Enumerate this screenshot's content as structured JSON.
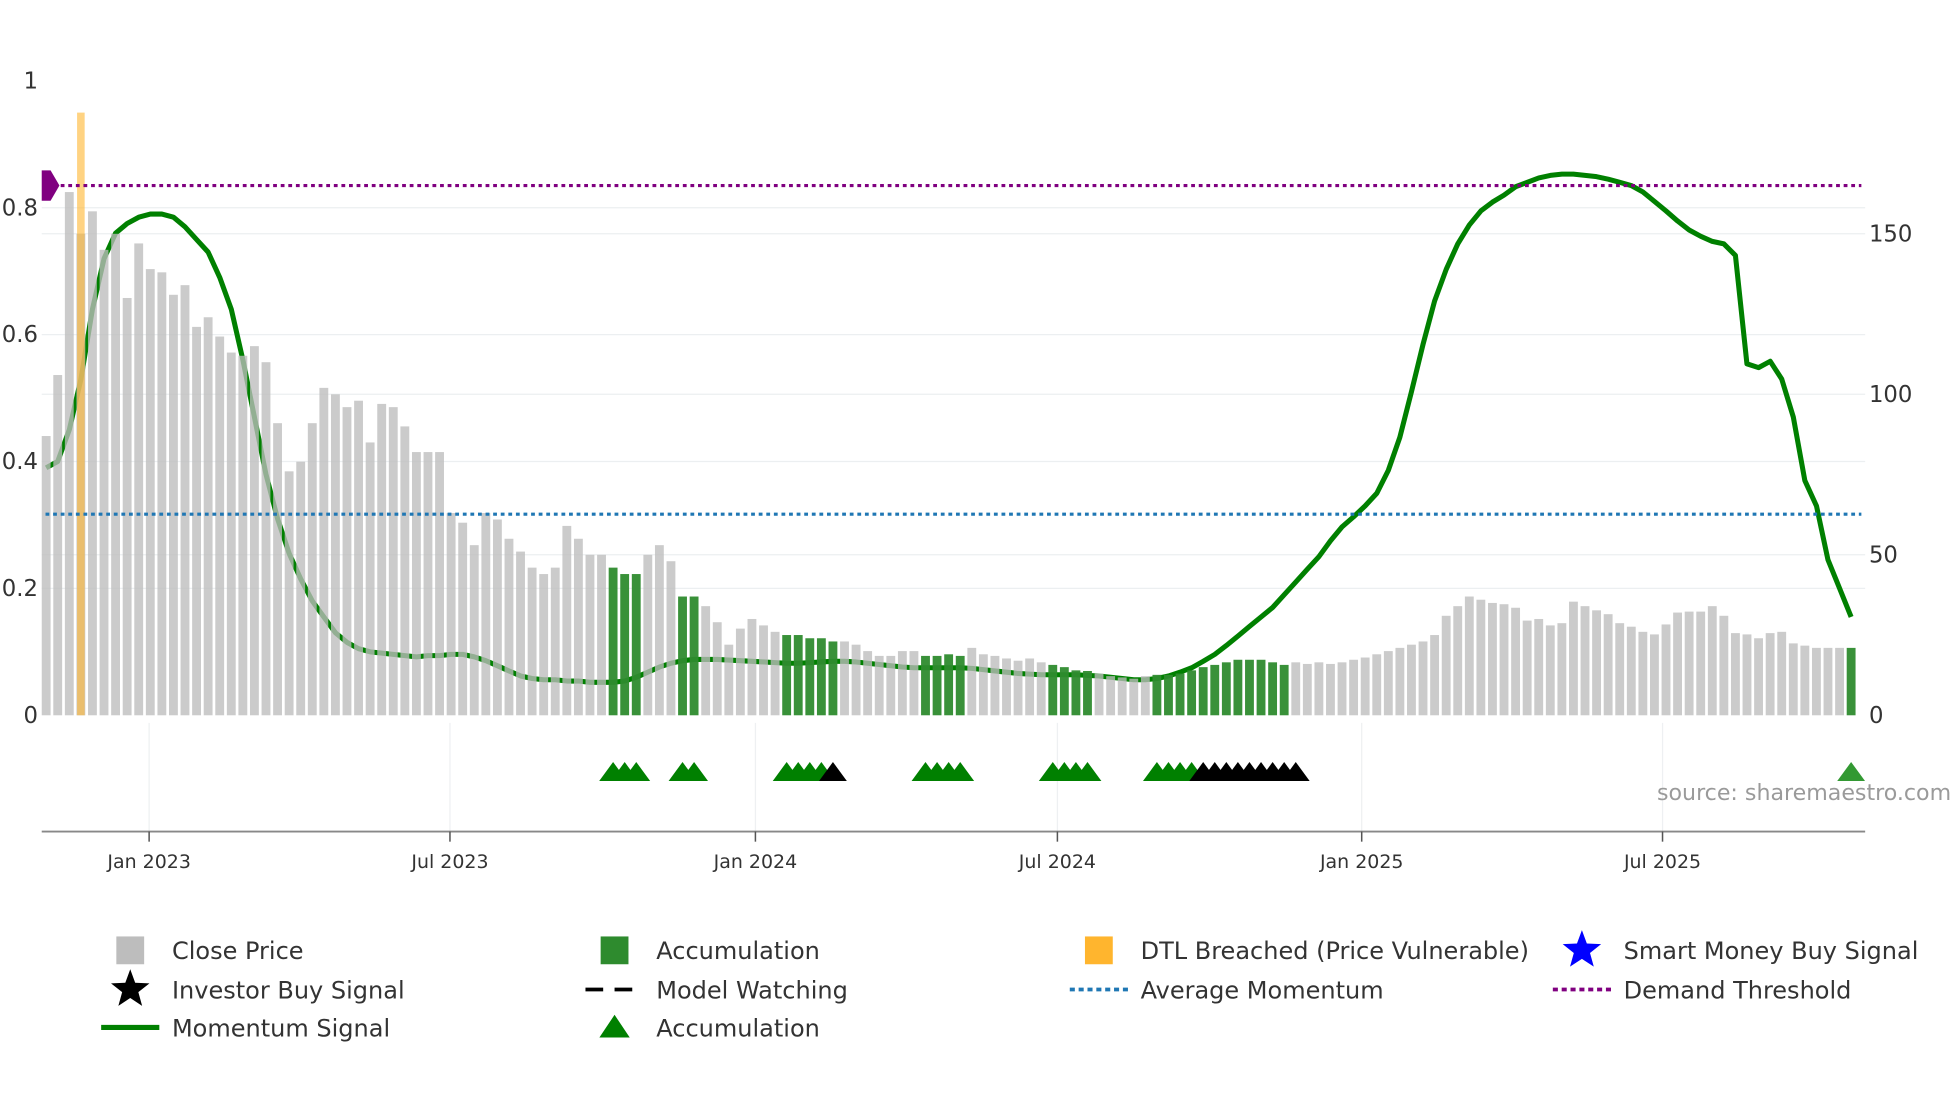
{
  "chart_data": {
    "type": "bar",
    "x_unit": "week index (weekly bars, Nov 2022 - Oct 2025)",
    "colors": {
      "close_price": "#bdbdbd",
      "accumulation_bar": "#2e8b2e",
      "dtl_breached": "#ffb52e",
      "momentum": "#008000",
      "average_momentum": "#1f77b4",
      "demand_threshold": "#800080",
      "investor_signal": "#000000",
      "smart_money": "#0000ff",
      "accumulation_marker": "#008000"
    },
    "left_axis": {
      "ylim": [
        0,
        1
      ],
      "ticks": [
        "0",
        "0.2",
        "0.4",
        "0.6",
        "0.8",
        "1"
      ],
      "tick_values": [
        0,
        0.2,
        0.4,
        0.6,
        0.8,
        1
      ]
    },
    "right_axis": {
      "ylim": [
        0,
        175
      ],
      "ticks": [
        "0",
        "50",
        "100",
        "150"
      ],
      "tick_values": [
        0,
        50,
        100,
        150
      ]
    },
    "x_ticks": [
      {
        "label": "Jan 2023",
        "week": 8.9
      },
      {
        "label": "Jul 2023",
        "week": 34.9
      },
      {
        "label": "Jan 2024",
        "week": 61.3
      },
      {
        "label": "Jul 2024",
        "week": 87.4
      },
      {
        "label": "Jan 2025",
        "week": 113.7
      },
      {
        "label": "Jul 2025",
        "week": 139.7
      }
    ],
    "close_price": [
      87,
      106,
      163,
      150,
      157,
      145,
      150,
      130,
      147,
      139,
      138,
      131,
      134,
      121,
      124,
      118,
      113,
      112,
      115,
      110,
      91,
      76,
      79,
      91,
      102,
      100,
      96,
      98,
      85,
      97,
      96,
      90,
      82,
      82,
      82,
      63,
      60,
      53,
      63,
      61,
      55,
      51,
      46,
      44,
      46,
      59,
      55,
      50,
      50,
      46,
      44,
      44,
      50,
      53,
      48,
      37,
      37,
      34,
      29,
      22,
      27,
      30,
      28,
      26,
      25,
      25,
      24,
      24,
      23,
      23,
      22,
      20,
      18.5,
      18.5,
      20,
      20,
      18.5,
      18.5,
      19,
      18.5,
      21,
      19,
      18.5,
      17.7,
      17,
      17.7,
      16.5,
      15.7,
      15,
      14,
      13.8,
      13,
      12.2,
      11.8,
      11.4,
      12.2,
      12.6,
      12.6,
      13,
      14,
      15,
      15.7,
      16.5,
      17.3,
      17.3,
      17.3,
      16.5,
      15.7,
      16.5,
      16,
      16.5,
      16,
      16.5,
      17.3,
      18,
      19,
      20,
      21,
      22,
      23,
      25,
      31,
      34,
      37,
      36,
      35,
      34.6,
      33.5,
      29.5,
      30,
      28,
      28.7,
      35.4,
      34,
      32.7,
      31.5,
      28.7,
      27.6,
      26,
      25.2,
      28.3,
      32,
      32.3,
      32.3,
      34,
      31,
      25.6,
      25.2,
      24,
      25.6,
      26,
      22.4,
      21.7,
      21,
      21,
      21,
      21
    ],
    "accumulation_weeks": [
      49,
      50,
      51,
      55,
      56,
      64,
      65,
      66,
      67,
      68,
      76,
      77,
      78,
      79,
      87,
      88,
      89,
      90,
      96,
      97,
      98,
      99,
      100,
      101,
      102,
      103,
      104,
      105,
      106,
      107,
      156
    ],
    "dtl_breached": [
      {
        "week": 3,
        "value": 0.95
      }
    ],
    "momentum": [
      0.39,
      0.4,
      0.45,
      0.53,
      0.64,
      0.72,
      0.76,
      0.775,
      0.785,
      0.79,
      0.79,
      0.785,
      0.77,
      0.75,
      0.73,
      0.69,
      0.64,
      0.56,
      0.47,
      0.38,
      0.31,
      0.255,
      0.215,
      0.18,
      0.155,
      0.13,
      0.115,
      0.105,
      0.1,
      0.098,
      0.096,
      0.094,
      0.092,
      0.094,
      0.094,
      0.096,
      0.096,
      0.092,
      0.086,
      0.078,
      0.07,
      0.062,
      0.058,
      0.056,
      0.056,
      0.054,
      0.054,
      0.052,
      0.052,
      0.052,
      0.054,
      0.06,
      0.068,
      0.076,
      0.082,
      0.086,
      0.088,
      0.088,
      0.088,
      0.087,
      0.086,
      0.085,
      0.084,
      0.083,
      0.082,
      0.082,
      0.083,
      0.084,
      0.085,
      0.085,
      0.084,
      0.082,
      0.08,
      0.078,
      0.076,
      0.075,
      0.075,
      0.075,
      0.075,
      0.075,
      0.074,
      0.072,
      0.07,
      0.068,
      0.066,
      0.065,
      0.064,
      0.064,
      0.064,
      0.064,
      0.063,
      0.062,
      0.06,
      0.058,
      0.056,
      0.056,
      0.058,
      0.062,
      0.068,
      0.075,
      0.085,
      0.096,
      0.11,
      0.125,
      0.14,
      0.155,
      0.17,
      0.19,
      0.21,
      0.23,
      0.25,
      0.275,
      0.297,
      0.313,
      0.33,
      0.35,
      0.386,
      0.438,
      0.51,
      0.585,
      0.653,
      0.703,
      0.743,
      0.773,
      0.795,
      0.809,
      0.82,
      0.833,
      0.84,
      0.847,
      0.851,
      0.853,
      0.853,
      0.851,
      0.849,
      0.845,
      0.84,
      0.835,
      0.825,
      0.81,
      0.795,
      0.779,
      0.765,
      0.755,
      0.747,
      0.743,
      0.725,
      0.554,
      0.548,
      0.558,
      0.53,
      0.47,
      0.37,
      0.33,
      0.245,
      0.2,
      0.155
    ],
    "average_momentum": 0.317,
    "demand_threshold": 0.835,
    "accumulation_markers": [
      49,
      50,
      51,
      55,
      56,
      64,
      65,
      66,
      67,
      76,
      77,
      78,
      79,
      87,
      88,
      89,
      90,
      96,
      97,
      98,
      99,
      156
    ],
    "investor_buy_markers": [
      68,
      100,
      101,
      102,
      103,
      104,
      105,
      106,
      107,
      108
    ],
    "source": "source: sharemaestro.com",
    "legend": [
      {
        "label": "Close Price",
        "symbol": "square",
        "color_key": "close_price"
      },
      {
        "label": "Accumulation",
        "symbol": "square",
        "color_key": "accumulation_bar"
      },
      {
        "label": "DTL Breached (Price Vulnerable)",
        "symbol": "square",
        "color_key": "dtl_breached"
      },
      {
        "label": "Smart Money Buy Signal",
        "symbol": "star",
        "color_key": "smart_money"
      },
      {
        "label": "Investor Buy Signal",
        "symbol": "star",
        "color_key": "investor_signal"
      },
      {
        "label": "Model Watching",
        "symbol": "dash",
        "color_key": "investor_signal"
      },
      {
        "label": "Average Momentum",
        "symbol": "dot",
        "color_key": "average_momentum"
      },
      {
        "label": "Demand Threshold",
        "symbol": "dot",
        "color_key": "demand_threshold"
      },
      {
        "label": "Momentum Signal",
        "symbol": "line",
        "color_key": "momentum"
      },
      {
        "label": "Accumulation",
        "symbol": "triangle",
        "color_key": "accumulation_marker"
      }
    ]
  }
}
